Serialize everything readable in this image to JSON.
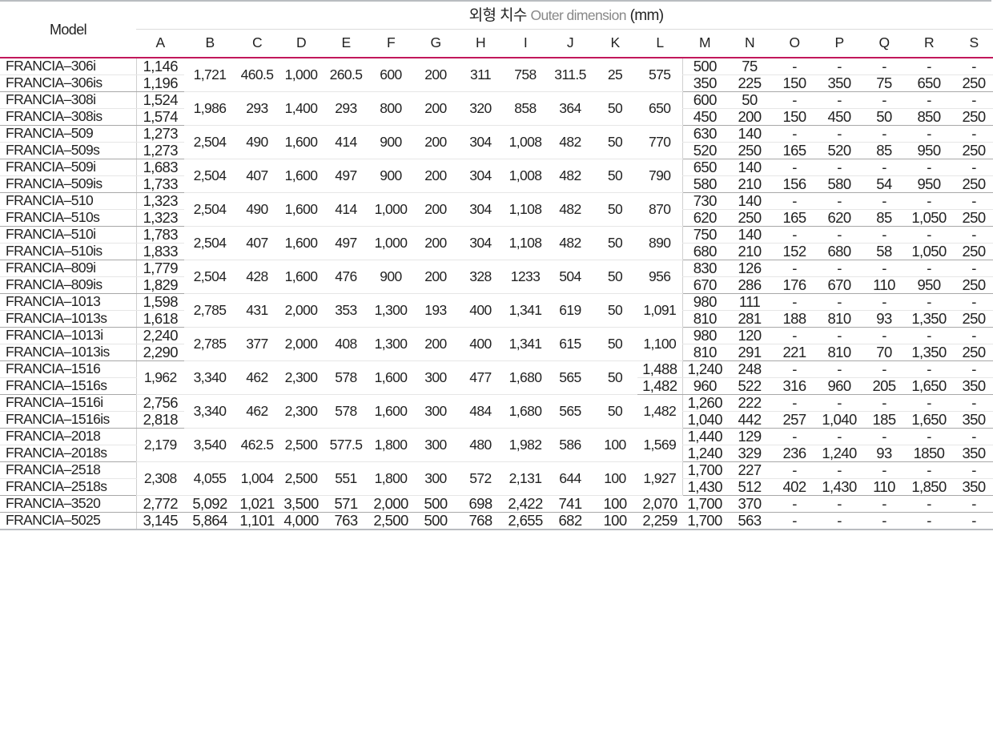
{
  "header": {
    "model_label": "Model",
    "dim_korean": "외형 치수",
    "dim_english": "Outer dimension",
    "dim_unit": "(mm)",
    "columns": [
      "A",
      "B",
      "C",
      "D",
      "E",
      "F",
      "G",
      "H",
      "I",
      "J",
      "K",
      "L",
      "M",
      "N",
      "O",
      "P",
      "Q",
      "R",
      "S"
    ]
  },
  "groups": [
    {
      "models": [
        "FRANCIA–306i",
        "FRANCIA–306is"
      ],
      "A": [
        "1,146",
        "1,196"
      ],
      "shared": [
        "1,721",
        "460.5",
        "1,000",
        "260.5",
        "600",
        "200",
        "311",
        "758",
        "311.5",
        "25",
        "575"
      ],
      "L_split": null,
      "MS": [
        [
          "500",
          "75",
          "-",
          "-",
          "-",
          "-",
          "-"
        ],
        [
          "350",
          "225",
          "150",
          "350",
          "75",
          "650",
          "250"
        ]
      ]
    },
    {
      "models": [
        "FRANCIA–308i",
        "FRANCIA–308is"
      ],
      "A": [
        "1,524",
        "1,574"
      ],
      "shared": [
        "1,986",
        "293",
        "1,400",
        "293",
        "800",
        "200",
        "320",
        "858",
        "364",
        "50",
        "650"
      ],
      "L_split": null,
      "MS": [
        [
          "600",
          "50",
          "-",
          "-",
          "-",
          "-",
          "-"
        ],
        [
          "450",
          "200",
          "150",
          "450",
          "50",
          "850",
          "250"
        ]
      ]
    },
    {
      "models": [
        "FRANCIA–509",
        "FRANCIA–509s"
      ],
      "A": [
        "1,273",
        "1,273"
      ],
      "shared": [
        "2,504",
        "490",
        "1,600",
        "414",
        "900",
        "200",
        "304",
        "1,008",
        "482",
        "50",
        "770"
      ],
      "L_split": null,
      "MS": [
        [
          "630",
          "140",
          "-",
          "-",
          "-",
          "-",
          "-"
        ],
        [
          "520",
          "250",
          "165",
          "520",
          "85",
          "950",
          "250"
        ]
      ]
    },
    {
      "models": [
        "FRANCIA–509i",
        "FRANCIA–509is"
      ],
      "A": [
        "1,683",
        "1,733"
      ],
      "shared": [
        "2,504",
        "407",
        "1,600",
        "497",
        "900",
        "200",
        "304",
        "1,008",
        "482",
        "50",
        "790"
      ],
      "L_split": null,
      "MS": [
        [
          "650",
          "140",
          "-",
          "-",
          "-",
          "-",
          "-"
        ],
        [
          "580",
          "210",
          "156",
          "580",
          "54",
          "950",
          "250"
        ]
      ]
    },
    {
      "models": [
        "FRANCIA–510",
        "FRANCIA–510s"
      ],
      "A": [
        "1,323",
        "1,323"
      ],
      "shared": [
        "2,504",
        "490",
        "1,600",
        "414",
        "1,000",
        "200",
        "304",
        "1,108",
        "482",
        "50",
        "870"
      ],
      "L_split": null,
      "MS": [
        [
          "730",
          "140",
          "-",
          "-",
          "-",
          "-",
          "-"
        ],
        [
          "620",
          "250",
          "165",
          "620",
          "85",
          "1,050",
          "250"
        ]
      ]
    },
    {
      "models": [
        "FRANCIA–510i",
        "FRANCIA–510is"
      ],
      "A": [
        "1,783",
        "1,833"
      ],
      "shared": [
        "2,504",
        "407",
        "1,600",
        "497",
        "1,000",
        "200",
        "304",
        "1,108",
        "482",
        "50",
        "890"
      ],
      "L_split": null,
      "MS": [
        [
          "750",
          "140",
          "-",
          "-",
          "-",
          "-",
          "-"
        ],
        [
          "680",
          "210",
          "152",
          "680",
          "58",
          "1,050",
          "250"
        ]
      ]
    },
    {
      "models": [
        "FRANCIA–809i",
        "FRANCIA–809is"
      ],
      "A": [
        "1,779",
        "1,829"
      ],
      "shared": [
        "2,504",
        "428",
        "1,600",
        "476",
        "900",
        "200",
        "328",
        "1233",
        "504",
        "50",
        "956"
      ],
      "L_split": null,
      "MS": [
        [
          "830",
          "126",
          "-",
          "-",
          "-",
          "-",
          "-"
        ],
        [
          "670",
          "286",
          "176",
          "670",
          "110",
          "950",
          "250"
        ]
      ]
    },
    {
      "models": [
        "FRANCIA–1013",
        "FRANCIA–1013s"
      ],
      "A": [
        "1,598",
        "1,618"
      ],
      "shared": [
        "2,785",
        "431",
        "2,000",
        "353",
        "1,300",
        "193",
        "400",
        "1,341",
        "619",
        "50",
        "1,091"
      ],
      "L_split": null,
      "MS": [
        [
          "980",
          "111",
          "-",
          "-",
          "-",
          "-",
          "-"
        ],
        [
          "810",
          "281",
          "188",
          "810",
          "93",
          "1,350",
          "250"
        ]
      ]
    },
    {
      "models": [
        "FRANCIA–1013i",
        "FRANCIA–1013is"
      ],
      "A": [
        "2,240",
        "2,290"
      ],
      "shared": [
        "2,785",
        "377",
        "2,000",
        "408",
        "1,300",
        "200",
        "400",
        "1,341",
        "615",
        "50",
        "1,100"
      ],
      "L_split": null,
      "MS": [
        [
          "980",
          "120",
          "-",
          "-",
          "-",
          "-",
          "-"
        ],
        [
          "810",
          "291",
          "221",
          "810",
          "70",
          "1,350",
          "250"
        ]
      ]
    },
    {
      "models": [
        "FRANCIA–1516",
        "FRANCIA–1516s"
      ],
      "A": [
        "1,962"
      ],
      "shared": [
        "3,340",
        "462",
        "2,300",
        "578",
        "1,600",
        "300",
        "477",
        "1,680",
        "565",
        "50"
      ],
      "L_split": [
        "1,488",
        "1,482"
      ],
      "MS": [
        [
          "1,240",
          "248",
          "-",
          "-",
          "-",
          "-",
          "-"
        ],
        [
          "960",
          "522",
          "316",
          "960",
          "205",
          "1,650",
          "350"
        ]
      ]
    },
    {
      "models": [
        "FRANCIA–1516i",
        "FRANCIA–1516is"
      ],
      "A": [
        "2,756",
        "2,818"
      ],
      "shared": [
        "3,340",
        "462",
        "2,300",
        "578",
        "1,600",
        "300",
        "484",
        "1,680",
        "565",
        "50",
        "1,482"
      ],
      "L_split": null,
      "MS": [
        [
          "1,260",
          "222",
          "-",
          "-",
          "-",
          "-",
          "-"
        ],
        [
          "1,040",
          "442",
          "257",
          "1,040",
          "185",
          "1,650",
          "350"
        ]
      ]
    },
    {
      "models": [
        "FRANCIA–2018",
        "FRANCIA–2018s"
      ],
      "A": [
        "2,179"
      ],
      "shared": [
        "3,540",
        "462.5",
        "2,500",
        "577.5",
        "1,800",
        "300",
        "480",
        "1,982",
        "586",
        "100",
        "1,569"
      ],
      "L_split": null,
      "MS": [
        [
          "1,440",
          "129",
          "-",
          "-",
          "-",
          "-",
          "-"
        ],
        [
          "1,240",
          "329",
          "236",
          "1,240",
          "93",
          "1850",
          "350"
        ]
      ]
    },
    {
      "models": [
        "FRANCIA–2518",
        "FRANCIA–2518s"
      ],
      "A": [
        "2,308"
      ],
      "shared": [
        "4,055",
        "1,004",
        "2,500",
        "551",
        "1,800",
        "300",
        "572",
        "2,131",
        "644",
        "100",
        "1,927"
      ],
      "L_split": null,
      "MS": [
        [
          "1,700",
          "227",
          "-",
          "-",
          "-",
          "-",
          "-"
        ],
        [
          "1,430",
          "512",
          "402",
          "1,430",
          "110",
          "1,850",
          "350"
        ]
      ]
    }
  ],
  "singles": [
    {
      "model": "FRANCIA–3520",
      "values": [
        "2,772",
        "5,092",
        "1,021",
        "3,500",
        "571",
        "2,000",
        "500",
        "698",
        "2,422",
        "741",
        "100",
        "2,070",
        "1,700",
        "370",
        "-",
        "-",
        "-",
        "-",
        "-"
      ]
    },
    {
      "model": "FRANCIA–5025",
      "values": [
        "3,145",
        "5,864",
        "1,101",
        "4,000",
        "763",
        "2,500",
        "500",
        "768",
        "2,655",
        "682",
        "100",
        "2,259",
        "1,700",
        "563",
        "-",
        "-",
        "-",
        "-",
        "-"
      ]
    }
  ]
}
